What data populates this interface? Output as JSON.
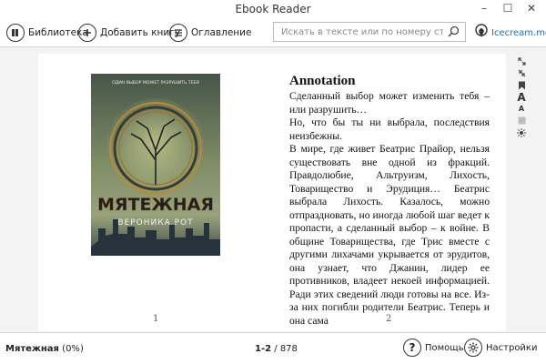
{
  "window": {
    "title": "Ebook Reader"
  },
  "toolbar": {
    "library_label": "Библиотека",
    "add_book_label": "Добавить книгу",
    "toc_label": "Оглавление",
    "search_placeholder": "Искать в тексте или по номеру страницы",
    "brand_label": "Icecream.me"
  },
  "book": {
    "cover_tagline": "ОДИН ВЫБОР МОЖЕТ РАЗРУШИТЬ ТЕБЯ",
    "cover_title": "МЯТЕЖНАЯ",
    "cover_author": "ВЕРОНИКА РОТ",
    "annotation_heading": "Annotation",
    "paragraphs": [
      "Сделанный выбор может изменить тебя – или разрушить…",
      "Но, что бы ты ни выбрала, последствия неизбежны.",
      "В мире, где живет Беатрис Прайор, нельзя существовать вне одной из фракций. Правдолюбие, Альтруизм, Лихость, Товарищество и Эрудиция… Беатрис выбрала Лихость. Казалось, можно отпраздновать, но иногда любой шаг ведет к пропасти, а сделанный выбор – к войне. В общине Товарищества, где Трис вместе с другими лихачами укрывается от эрудитов, она узнает, что Джанин, лидер ее противников, владеет некоей информацией. Ради этих сведений люди готовы на все. Из-за них погибли родители Беатрис. Теперь и она сама"
    ],
    "page_left": "1",
    "page_right": "2"
  },
  "status": {
    "book_title": "Мятежная",
    "progress_text": "(0%)",
    "current_pages": "1-2",
    "total_pages": "/ 878",
    "help_label": "Помощь",
    "settings_label": "Настройки"
  },
  "colors": {
    "accent": "#1b6fc4",
    "text": "#222222",
    "background": "#f3f3f3"
  }
}
